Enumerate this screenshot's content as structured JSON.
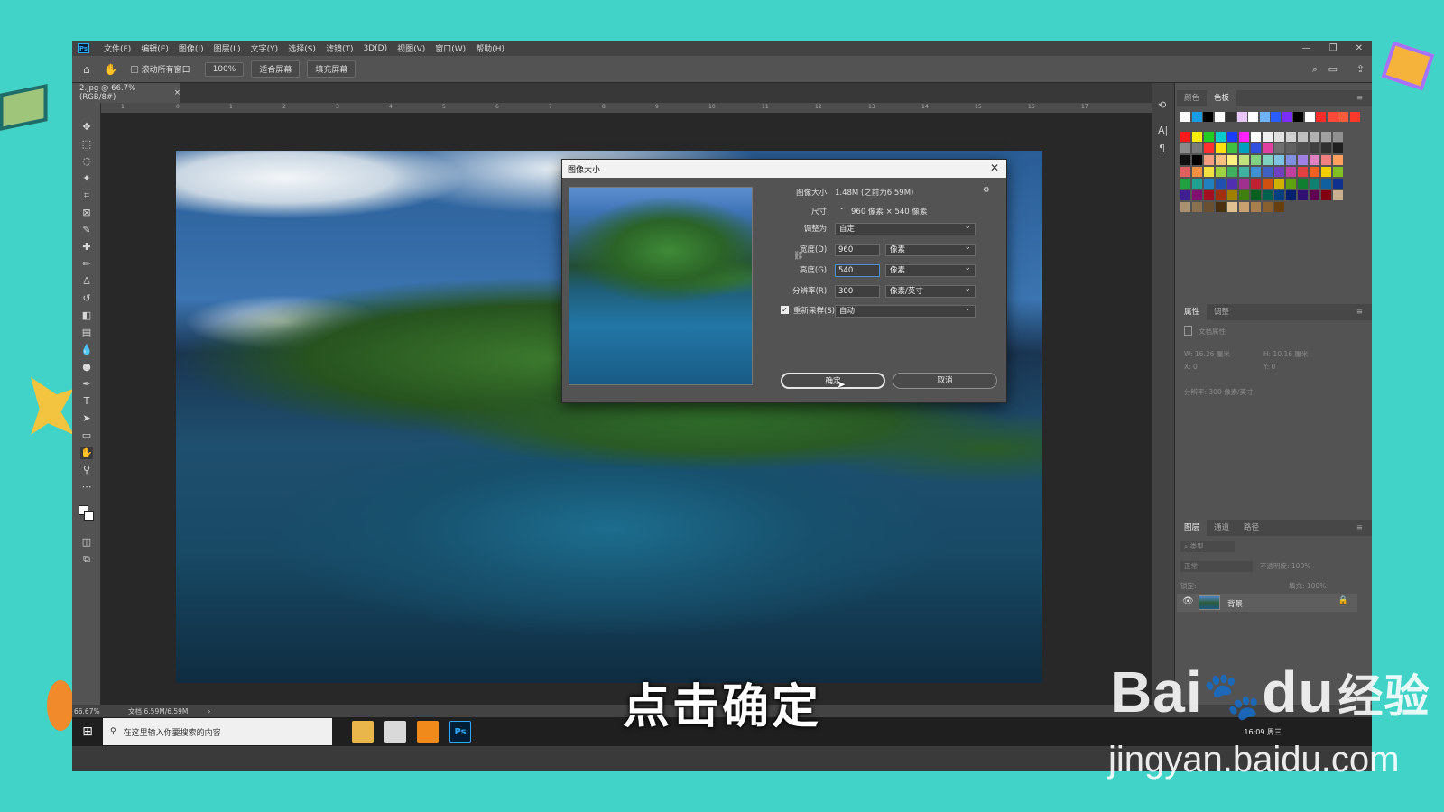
{
  "app": {
    "icon_text": "Ps"
  },
  "menu": [
    "文件(F)",
    "编辑(E)",
    "图像(I)",
    "图层(L)",
    "文字(Y)",
    "选择(S)",
    "滤镜(T)",
    "3D(D)",
    "视图(V)",
    "窗口(W)",
    "帮助(H)"
  ],
  "options": {
    "scroll_all_label": "滚动所有窗口",
    "zoom_btn": "100%",
    "fit_btn": "适合屏幕",
    "fill_btn": "填充屏幕"
  },
  "doc_tab": {
    "title": "2.jpg @ 66.7%(RGB/8#)"
  },
  "ruler_ticks": [
    "1",
    "0",
    "1",
    "2",
    "3",
    "4",
    "5",
    "6",
    "7",
    "8",
    "9",
    "10",
    "11",
    "12",
    "13",
    "14",
    "15",
    "16",
    "17"
  ],
  "dialog": {
    "title": "图像大小",
    "size_label": "图像大小:",
    "size_value": "1.48M (之前为6.59M)",
    "dims_label": "尺寸:",
    "dims_value": "960 像素 × 540 像素",
    "fit_label": "调整为:",
    "fit_value": "自定",
    "width_label": "宽度(D):",
    "width_value": "960",
    "width_unit": "像素",
    "height_label": "高度(G):",
    "height_value": "540",
    "height_unit": "像素",
    "res_label": "分辨率(R):",
    "res_value": "300",
    "res_unit": "像素/英寸",
    "resample_label": "重新采样(S):",
    "resample_value": "自动",
    "ok_label": "确定",
    "cancel_label": "取消"
  },
  "panels": {
    "color_tabs": [
      "颜色",
      "色板"
    ],
    "props_tabs": [
      "属性",
      "调整"
    ],
    "doc_props_label": "文档属性",
    "w_label": "W: 16.26 厘米",
    "h_label": "H: 10.16 厘米",
    "x_label": "X: 0",
    "y_label": "Y: 0",
    "res_label": "分辨率: 300 像素/英寸",
    "layer_tabs": [
      "图层",
      "通道",
      "路径"
    ],
    "kind_label": "类型",
    "blend_mode": "正常",
    "opacity_label": "不透明度: 100%",
    "lock_label": "锁定:",
    "fill_label": "填充: 100%",
    "layer_name": "背景"
  },
  "swatches_top": [
    "#ffffff",
    "#1a9be6",
    "#000000",
    "#ffffff",
    "#333333",
    "#e8c8ff",
    "#ffffff",
    "#6fb2ff",
    "#2a5dff",
    "#7a2dff",
    "#000000",
    "#ffffff",
    "#ff2a2a",
    "#ff4a3a",
    "#ff5a3a",
    "#ff3a2a"
  ],
  "swatches_grid": [
    [
      "#ff1a1a",
      "#ffee00",
      "#22cc22",
      "#00cccc",
      "#1a3cff",
      "#ff22ff",
      "#ffffff",
      "#f0f0f0",
      "#e0e0e0",
      "#d0d0d0",
      "#c0c0c0",
      "#b0b0b0",
      "#a0a0a0",
      "#909090"
    ],
    [
      "#8a8a8a",
      "#7a7a7a",
      "#ff3030",
      "#ffe010",
      "#40c040",
      "#00a0c0",
      "#3050e0",
      "#e040a0",
      "#707070",
      "#606060",
      "#505050",
      "#404040",
      "#303030",
      "#202020"
    ],
    [
      "#101010",
      "#000000",
      "#f0a080",
      "#f8c080",
      "#fff080",
      "#c0e080",
      "#80d080",
      "#80d0c0",
      "#80c0e0",
      "#8090e0",
      "#a080e0",
      "#e080c0",
      "#f08080",
      "#ffa060"
    ],
    [
      "#e06060",
      "#f09040",
      "#f0e040",
      "#a0d040",
      "#40b060",
      "#40b0a0",
      "#4090d0",
      "#4060c0",
      "#7040c0",
      "#c040a0",
      "#e04040",
      "#f06020",
      "#f0d000",
      "#80c020"
    ],
    [
      "#20a040",
      "#20a090",
      "#2080c0",
      "#2050b0",
      "#5030b0",
      "#a03090",
      "#c02030",
      "#d05010",
      "#d0b000",
      "#60a010",
      "#108030",
      "#108070",
      "#1060a0",
      "#103090"
    ],
    [
      "#402090",
      "#801070",
      "#a01020",
      "#a03010",
      "#a08000",
      "#408010",
      "#006020",
      "#006050",
      "#004080",
      "#002070",
      "#301070",
      "#600050",
      "#800010",
      "#c8b090"
    ],
    [
      "#a89070",
      "#887050",
      "#685030",
      "#483010",
      "#e0c090",
      "#c8a070",
      "#a88050",
      "#886030",
      "#684010"
    ]
  ],
  "statusbar": {
    "zoom": "66.67%",
    "doc": "文档:6.59M/6.59M"
  },
  "taskbar": {
    "search_placeholder": "在这里输入你要搜索的内容",
    "time": "16:09 周三"
  },
  "caption": "点击确定",
  "watermark": {
    "brand": "Bai",
    "brand2": "du",
    "brand3": "经验",
    "url": "jingyan.baidu.com"
  }
}
